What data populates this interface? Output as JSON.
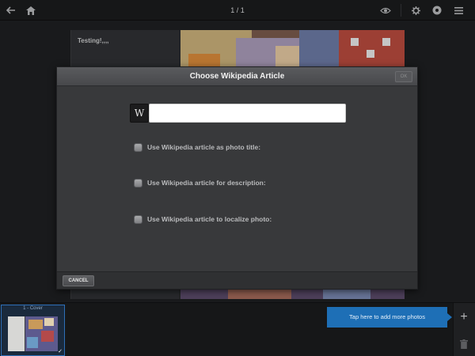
{
  "toolbar": {
    "page_counter": "1 / 1",
    "icons": [
      "back-arrow-icon",
      "home-icon",
      "eye-icon",
      "gear-icon",
      "info-icon",
      "menu-icon"
    ]
  },
  "background_page": {
    "text_panel": "Testing!,,,,"
  },
  "dialog": {
    "title": "Choose Wikipedia Article",
    "ok_label": "OK",
    "wiki_badge": "W",
    "search_value": "",
    "options": [
      {
        "label": "Use Wikipedia article as photo title:",
        "checked": false
      },
      {
        "label": "Use Wikipedia article for description:",
        "checked": false
      },
      {
        "label": "Use Wikipedia article to localize photo:",
        "checked": false
      }
    ],
    "cancel_label": "CANCEL"
  },
  "filmstrip": {
    "thumb_label": "1 - Cover",
    "add_photos_tip": "Tap here to add more photos",
    "add_label": "+"
  },
  "colors": {
    "accent": "#1e6fb6",
    "toolbar": "#161718",
    "dialog": "#38393b"
  }
}
